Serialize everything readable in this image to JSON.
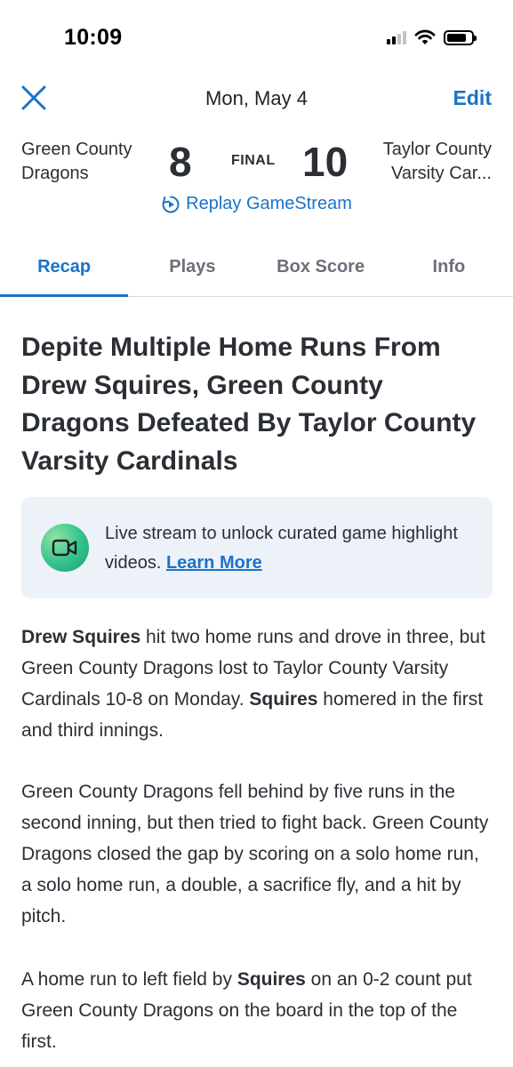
{
  "status_bar": {
    "time": "10:09",
    "icons": [
      "cellular-signal-icon",
      "wifi-icon",
      "battery-icon"
    ]
  },
  "header": {
    "date": "Mon, May 4",
    "edit_label": "Edit",
    "close_icon": "close-icon"
  },
  "scoreboard": {
    "home_team": "Green County Dragons",
    "home_score": "8",
    "status": "FINAL",
    "away_score": "10",
    "away_team_line1": "Taylor County",
    "away_team_line2": "Varsity Car...",
    "replay_label": "Replay GameStream",
    "replay_icon": "replay-icon"
  },
  "tabs": [
    {
      "label": "Recap",
      "active": true
    },
    {
      "label": "Plays",
      "active": false
    },
    {
      "label": "Box Score",
      "active": false
    },
    {
      "label": "Info",
      "active": false
    }
  ],
  "article": {
    "headline": "Depite Multiple Home Runs From Drew Squires, Green County Dragons Defeated By Taylor County Varsity Cardinals",
    "promo": {
      "icon": "video-camera-icon",
      "text": "Live stream to unlock curated game highlight videos.",
      "link": "Learn More"
    },
    "p1": {
      "name1": "Drew Squires",
      "text1": " hit two home runs and drove in three, but Green County Dragons lost to Taylor County Varsity Cardinals 10-8 on Monday. ",
      "name2": "Squires",
      "text2": " homered in the first and third innings."
    },
    "p2": "Green County Dragons fell behind by five runs in the second inning, but then tried to fight back. Green County Dragons closed the gap by scoring on a solo home run, a solo home run, a double, a sacrifice fly, and a hit by pitch.",
    "p3": {
      "text1": "A home run to left field by ",
      "name": "Squires",
      "text2": " on an 0-2 count put Green County Dragons on the board in the top of the first."
    }
  },
  "colors": {
    "accent": "#1a73c9",
    "text": "#2b2f35",
    "promo_bg": "#edf2f9",
    "muted": "#6b7079"
  }
}
